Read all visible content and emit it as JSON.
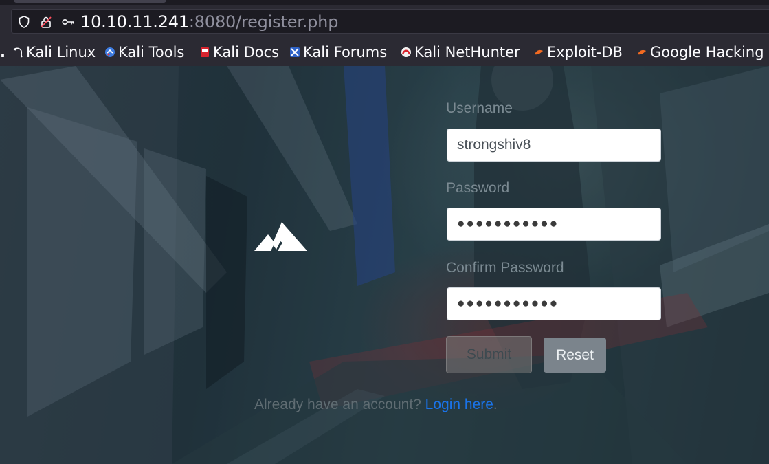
{
  "browser": {
    "url_host": "10.10.11.241",
    "url_path": ":8080/register.php"
  },
  "bookmarks": [
    {
      "label": "Kali Linux",
      "icon": "kali-dragon-icon"
    },
    {
      "label": "Kali Tools",
      "icon": "kali-tools-icon"
    },
    {
      "label": "Kali Docs",
      "icon": "kali-docs-icon"
    },
    {
      "label": "Kali Forums",
      "icon": "kali-forums-icon"
    },
    {
      "label": "Kali NetHunter",
      "icon": "kali-nethunter-icon"
    },
    {
      "label": "Exploit-DB",
      "icon": "exploit-db-icon"
    },
    {
      "label": "Google Hacking",
      "icon": "google-hacking-icon"
    }
  ],
  "form": {
    "username_label": "Username",
    "username_value": "strongshiv8",
    "password_label": "Password",
    "password_value": "●●●●●●●●●●●",
    "confirm_label": "Confirm Password",
    "confirm_value": "●●●●●●●●●●●",
    "submit_label": "Submit",
    "reset_label": "Reset"
  },
  "footer": {
    "prompt": "Already have an account? ",
    "link": "Login here",
    "end": "."
  },
  "colors": {
    "link": "#1a73e8",
    "reset_button": "#7b848c"
  }
}
